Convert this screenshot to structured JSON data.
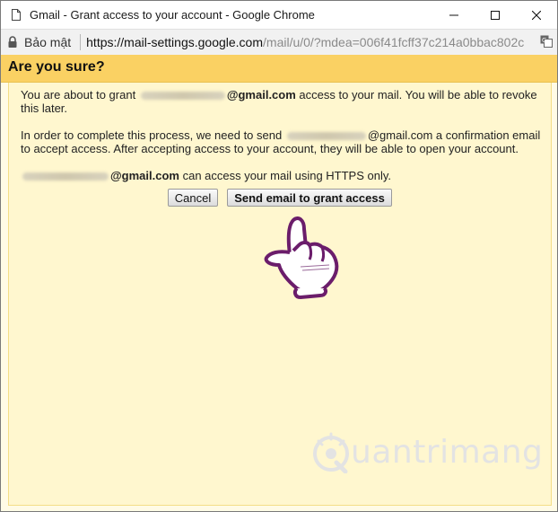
{
  "window": {
    "title": "Gmail - Grant access to your account - Google Chrome"
  },
  "addressbar": {
    "secure_label": "Bảo mật",
    "url_host": "https://mail-settings.google.com",
    "url_rest": "/mail/u/0/?mdea=006f41fcff37c214a0bbac802c"
  },
  "dialog": {
    "title": "Are you sure?",
    "para1_prefix": "You are about to grant",
    "para1_email_domain": "@gmail.com",
    "para1_suffix": "access to your mail. You will be able to revoke",
    "para1_line2": "this later.",
    "para2_prefix": "In order to complete this process, we need to send",
    "para2_email_domain": "@gmail.com",
    "para2_suffix": "a confirmation email",
    "para2_line2": "to accept access. After accepting access to your account, they will be able to open your account.",
    "para3_email_domain": "@gmail.com",
    "para3_suffix": "can access your mail using HTTPS only.",
    "cancel_label": "Cancel",
    "send_label": "Send email to grant access"
  },
  "watermark": {
    "text": "uantrimang"
  },
  "colors": {
    "header": "#fad163",
    "panel": "#fff7cf",
    "window_bg": "#fffbe6"
  }
}
